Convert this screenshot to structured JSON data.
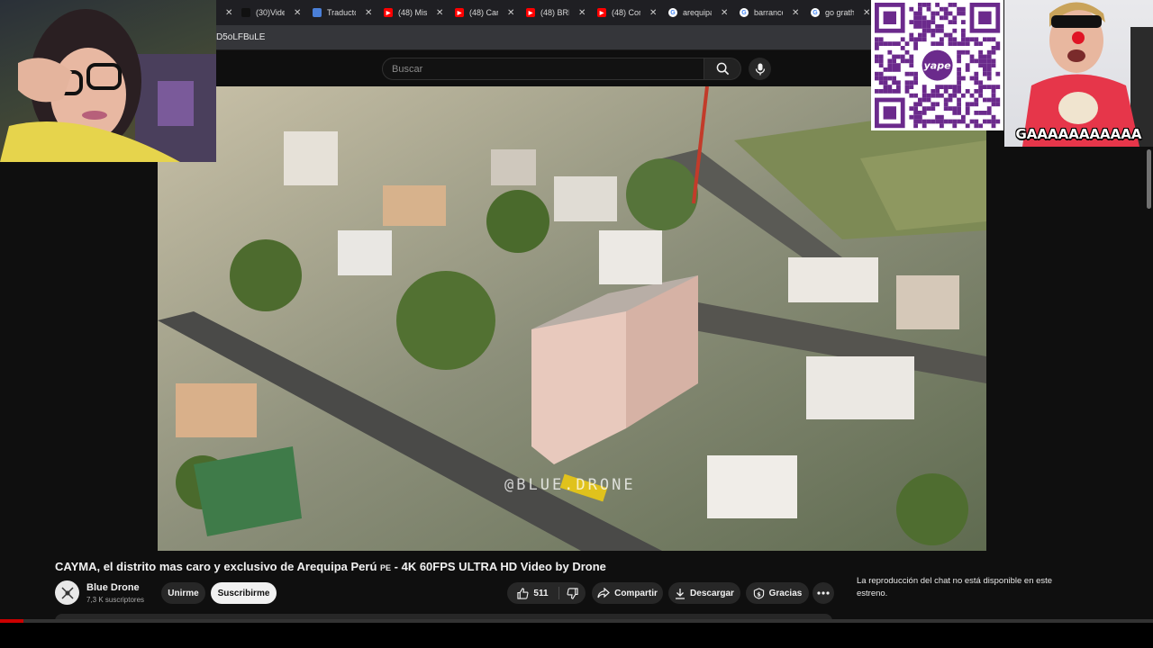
{
  "browser": {
    "tabs": [
      {
        "title": "(30)Vide",
        "icon": "tiktok-icon",
        "color": "#111111"
      },
      {
        "title": "Traducto",
        "icon": "translate-icon",
        "color": "#4a7fd8"
      },
      {
        "title": "(48) Mis",
        "icon": "youtube-icon",
        "color": "#ff0000"
      },
      {
        "title": "(48) Car",
        "icon": "youtube-icon",
        "color": "#ff0000"
      },
      {
        "title": "(48) BRN",
        "icon": "youtube-icon",
        "color": "#ff0000"
      },
      {
        "title": "(48) Con",
        "icon": "youtube-icon",
        "color": "#ff0000"
      },
      {
        "title": "arequipa",
        "icon": "google-icon",
        "color": "#ffffff"
      },
      {
        "title": "barranco",
        "icon": "google-icon",
        "color": "#ffffff"
      },
      {
        "title": "go grath",
        "icon": "google-icon",
        "color": "#ffffff"
      }
    ],
    "url_fragment": "D5oLFBuLE"
  },
  "header": {
    "search_placeholder": "Buscar"
  },
  "video": {
    "watermark": "@BLUE.DRONE",
    "title": "CAYMA, el distrito mas caro y exclusivo de Arequipa Perú",
    "title_country": "PE",
    "title_suffix": "- 4K 60FPS ULTRA HD Video by Drone",
    "progress": 0.02
  },
  "channel": {
    "name": "Blue Drone",
    "subscribers": "7,3 K suscriptores",
    "join_label": "Unirme",
    "subscribe_label": "Suscribirme"
  },
  "actions": {
    "likes": "511",
    "share_label": "Compartir",
    "download_label": "Descargar",
    "thanks_label": "Gracias"
  },
  "chat": {
    "message": "La reproducción del chat no está disponible en este estreno."
  },
  "overlay": {
    "qr_brand": "yape",
    "guest_caption": "GAAAAAAAAAAA"
  },
  "colors": {
    "accent_red": "#cc0000",
    "yape_purple": "#6b2a8c"
  }
}
